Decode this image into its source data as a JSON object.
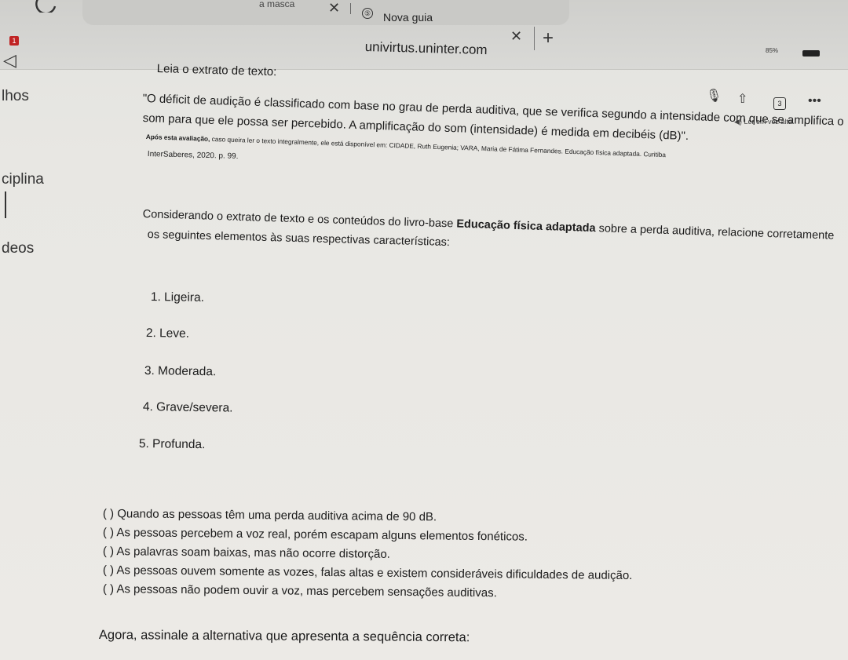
{
  "browser": {
    "prev_tab_title": "a masca",
    "active_tab_title": "Nova guia",
    "url": "univirtus.uninter.com",
    "battery_level": "85%",
    "notification_count": "1",
    "icons": {
      "reload": "reload-icon",
      "close": "close-icon",
      "new_tab": "plus-icon",
      "mic": "microphone-icon",
      "share": "share-icon",
      "tabs": "tabs-icon",
      "more": "more-icon",
      "listen": "speaker-icon",
      "back": "back-arrow-icon"
    },
    "tab_count": "3",
    "listen_label": "Ler em voz alta"
  },
  "sidebar": {
    "items": [
      {
        "label": "lhos"
      },
      {
        "label": "ciplina"
      },
      {
        "label": "deos"
      }
    ]
  },
  "question": {
    "intro": "Leia o extrato de texto:",
    "quote_line1": "\"O déficit de audição é classificado com base no grau de perda auditiva, que se verifica segundo a intensidade com que se amplifica o",
    "quote_line2": "som para que ele possa ser percebido. A amplificação do som (intensidade) é medida em decibéis (dB)\".",
    "source_bold": "Após esta avaliação,",
    "source_rest": " caso queira ler o texto integralmente, ele está disponível em: CIDADE, Ruth Eugenia; VARA, Maria de Fátima Fernandes. Educação física adaptada. Curitiba",
    "source_line2": "InterSaberes, 2020. p. 99.",
    "consider_line1_pre": "Considerando o extrato de texto e os conteúdos do livro-base ",
    "consider_line1_bold": "Educação física adaptada",
    "consider_line1_post": " sobre a perda auditiva, relacione corretamente",
    "consider_line2": "os seguintes elementos às suas respectivas características:",
    "items": [
      "1. Ligeira.",
      "2. Leve.",
      "3. Moderada.",
      "4. Grave/severa.",
      "5. Profunda."
    ],
    "associations": [
      "( ) Quando as pessoas têm uma perda auditiva acima de 90 dB.",
      "( ) As pessoas percebem a voz real, porém escapam alguns elementos fonéticos.",
      "( ) As palavras soam baixas, mas não ocorre distorção.",
      "( ) As pessoas ouvem somente as vozes, falas altas e existem consideráveis dificuldades de audição.",
      "( ) As pessoas não podem ouvir a voz, mas percebem sensações auditivas."
    ],
    "final": "Agora, assinale a alternativa que apresenta a sequência correta:"
  }
}
